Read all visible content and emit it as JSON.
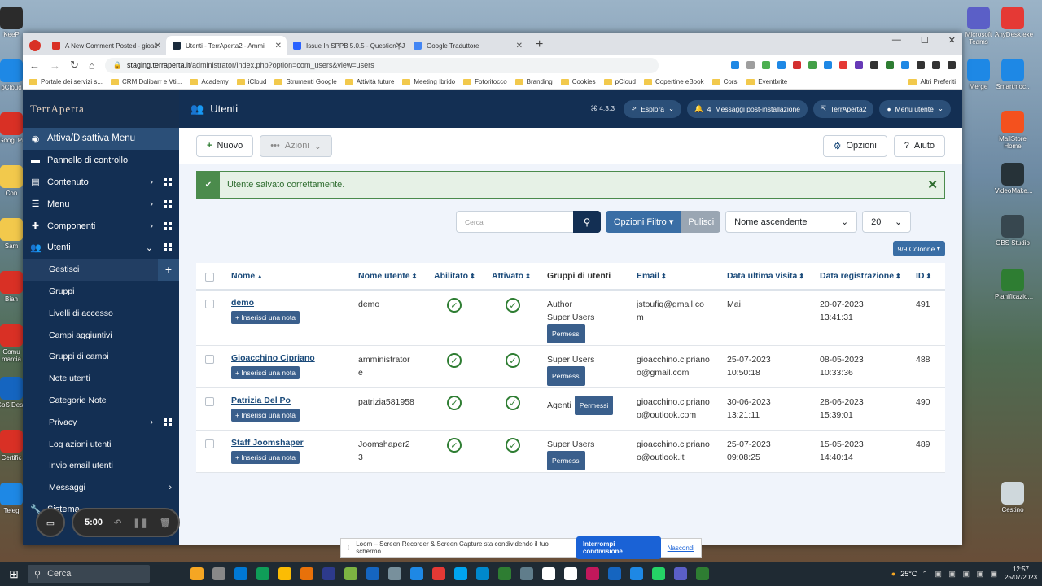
{
  "desktop": {
    "icons_left": [
      "KeeP",
      "pCloud",
      "Googl Pr",
      "Con",
      "Sam",
      "Bian",
      "Comu marcia",
      "GoS Desk",
      "Certific",
      "Teleg"
    ],
    "icons_right": [
      "Microsoft Teams",
      "AnyDesk.exe",
      "Merge",
      "Smartmoc..",
      "MailStore Home",
      "VideoMake...",
      "OBS Studio",
      "Pianificazio...",
      "Cestino"
    ]
  },
  "browser": {
    "tabs": [
      {
        "label": "A New Comment Posted - gioac",
        "active": false,
        "color": "#d93025"
      },
      {
        "label": "Utenti - TerrAperta2 - Ammi",
        "active": true,
        "color": "#1a2b3c"
      },
      {
        "label": "Issue In SPPB 5.0.5 - Question | J",
        "active": false,
        "color": "#2962ff"
      },
      {
        "label": "Google Traduttore",
        "active": false,
        "color": "#4285f4"
      }
    ],
    "url_host": "staging.terraperta.it",
    "url_path": "/administrator/index.php?option=com_users&view=users",
    "bookmarks": [
      "Portale dei servizi s...",
      "CRM Dolibarr e Vti...",
      "Academy",
      "iCloud",
      "Strumenti Google",
      "Attività future",
      "Meeting Ibrido",
      "Fotoritocco",
      "Branding",
      "Cookies",
      "pCloud",
      "Copertine eBook",
      "Corsi",
      "Eventbrite"
    ],
    "bookmarks_more": "Altri Preferiti"
  },
  "sidebar": {
    "logo": "TerrAperta",
    "toggle": "Attiva/Disattiva Menu",
    "items": [
      {
        "label": "Pannello di controllo",
        "icon": "home-icon",
        "arrow": false,
        "grid": false
      },
      {
        "label": "Contenuto",
        "icon": "file-icon",
        "arrow": true,
        "grid": true
      },
      {
        "label": "Menu",
        "icon": "list-icon",
        "arrow": true,
        "grid": true
      },
      {
        "label": "Componenti",
        "icon": "puzzle-icon",
        "arrow": true,
        "grid": true
      },
      {
        "label": "Utenti",
        "icon": "users-icon",
        "arrow": true,
        "grid": true
      }
    ],
    "subitems": [
      {
        "label": "Gestisci",
        "active": true
      },
      {
        "label": "Gruppi"
      },
      {
        "label": "Livelli di accesso"
      },
      {
        "label": "Campi aggiuntivi"
      },
      {
        "label": "Gruppi di campi"
      },
      {
        "label": "Note utenti"
      },
      {
        "label": "Categorie Note"
      },
      {
        "label": "Privacy",
        "arrow": true
      },
      {
        "label": "Log azioni utenti"
      },
      {
        "label": "Invio email utenti"
      },
      {
        "label": "Messaggi",
        "arrow": true
      }
    ],
    "sistema": "Sistema"
  },
  "topbar": {
    "title": "Utenti",
    "version": "4.3.3",
    "explore": "Esplora",
    "notif_count": "4",
    "postinstall": "Messaggi post-installazione",
    "site": "TerrAperta2",
    "user_menu": "Menu utente"
  },
  "toolbar": {
    "new": "Nuovo",
    "actions": "Azioni",
    "options": "Opzioni",
    "help": "Aiuto"
  },
  "alert": "Utente salvato correttamente.",
  "filters": {
    "search_placeholder": "Cerca",
    "filter_options": "Opzioni Filtro",
    "clear": "Pulisci",
    "sort": "Nome ascendente",
    "limit": "20",
    "columns": "9/9 Colonne"
  },
  "table": {
    "headers": {
      "name": "Nome",
      "username": "Nome utente",
      "enabled": "Abilitato",
      "activated": "Attivato",
      "groups": "Gruppi di utenti",
      "email": "Email",
      "last_visit": "Data ultima visita",
      "registered": "Data registrazione",
      "id": "ID"
    },
    "note_label": "Inserisci una nota",
    "perm_label": "Permessi",
    "rows": [
      {
        "name": "demo",
        "username": "demo",
        "username2": "",
        "groups": [
          "Author",
          "Super Users"
        ],
        "email1": "jstoufiq@gmail.co",
        "email2": "m",
        "visit1": "Mai",
        "visit2": "",
        "reg1": "20-07-2023",
        "reg2": "13:41:31",
        "id": "491"
      },
      {
        "name": "Gioacchino Cipriano",
        "username": "amministrator",
        "username2": "e",
        "groups": [
          "Super Users"
        ],
        "email1": "gioacchino.cipriano",
        "email2": "o@gmail.com",
        "visit1": "25-07-2023",
        "visit2": "10:50:18",
        "reg1": "08-05-2023",
        "reg2": "10:33:36",
        "id": "488"
      },
      {
        "name": "Patrizia Del Po",
        "username": "patrizia581958",
        "username2": "",
        "groups": [
          "Agenti"
        ],
        "email1": "gioacchino.cipriano",
        "email2": "o@outlook.com",
        "visit1": "30-06-2023",
        "visit2": "13:21:11",
        "reg1": "28-06-2023",
        "reg2": "15:39:01",
        "id": "490"
      },
      {
        "name": "Staff Joomshaper",
        "username": "Joomshaper2",
        "username2": "3",
        "groups": [
          "Super Users"
        ],
        "email1": "gioacchino.cipriano",
        "email2": "o@outlook.it",
        "visit1": "25-07-2023",
        "visit2": "09:08:25",
        "reg1": "15-05-2023",
        "reg2": "14:40:14",
        "id": "489"
      }
    ]
  },
  "loom": {
    "timer": "5:00",
    "banner": "Loom – Screen Recorder & Screen Capture sta condividendo il tuo schermo.",
    "stop": "Interrompi condivisione",
    "hide": "Nascondi"
  },
  "taskbar": {
    "search": "Cerca",
    "temp": "25°C",
    "time": "12:57",
    "date": "25/07/2023"
  }
}
